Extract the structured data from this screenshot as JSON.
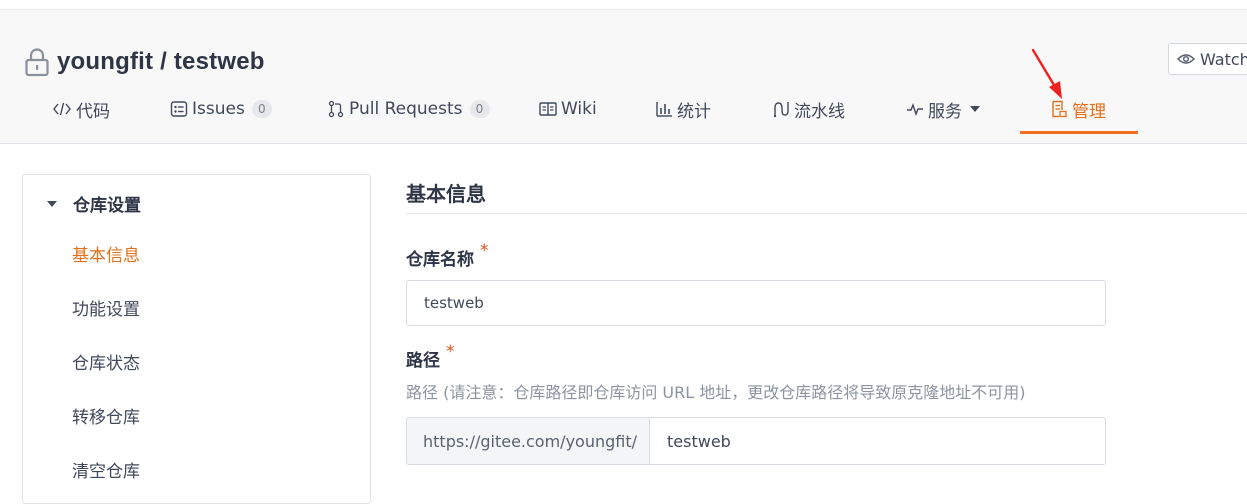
{
  "repo": {
    "title": "youngfit / testweb",
    "watch_label": "Watch"
  },
  "tabs": [
    {
      "id": "code",
      "label": "代码",
      "icon": "code-icon"
    },
    {
      "id": "issues",
      "label": "Issues",
      "icon": "issues-icon",
      "count": "0"
    },
    {
      "id": "pulls",
      "label": "Pull Requests",
      "icon": "pull-request-icon",
      "count": "0"
    },
    {
      "id": "wiki",
      "label": "Wiki",
      "icon": "wiki-icon"
    },
    {
      "id": "stats",
      "label": "统计",
      "icon": "stats-icon"
    },
    {
      "id": "pipeline",
      "label": "流水线",
      "icon": "pipeline-icon"
    },
    {
      "id": "services",
      "label": "服务",
      "icon": "pulse-icon"
    },
    {
      "id": "manage",
      "label": "管理",
      "icon": "manage-icon",
      "active": true
    }
  ],
  "sidebar": {
    "heading": "仓库设置",
    "items": [
      {
        "label": "基本信息",
        "active": true
      },
      {
        "label": "功能设置"
      },
      {
        "label": "仓库状态"
      },
      {
        "label": "转移仓库"
      },
      {
        "label": "清空仓库"
      }
    ]
  },
  "main": {
    "title": "基本信息",
    "repo_name_label": "仓库名称",
    "repo_name_value": "testweb",
    "path_label": "路径",
    "path_hint": "路径 (请注意：仓库路径即仓库访问 URL 地址，更改仓库路径将导致原克隆地址不可用)",
    "path_prefix": "https://gitee.com/youngfit/",
    "path_value": "testweb",
    "required_mark": "*"
  },
  "colors": {
    "accent": "#f37021",
    "active_text": "#e2701b",
    "required": "#e2501b",
    "arrow": "#f02020"
  }
}
